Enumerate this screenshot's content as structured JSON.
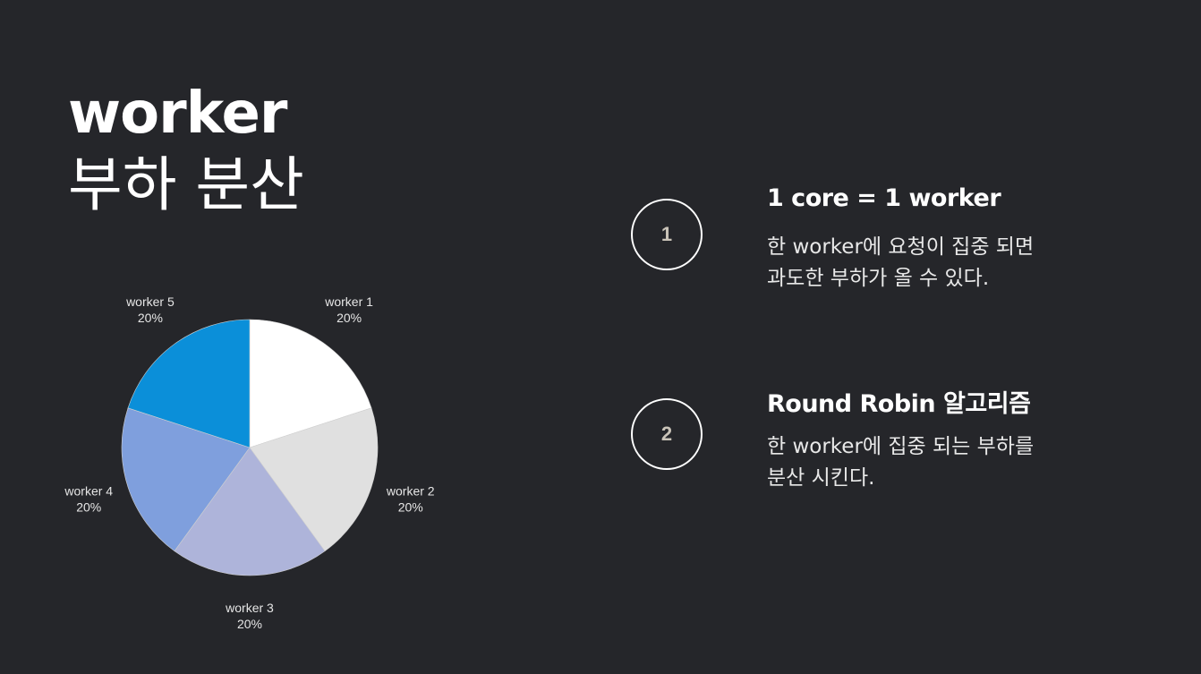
{
  "title": {
    "line1": "worker",
    "line2": "부하 분산"
  },
  "steps": [
    {
      "number": "1",
      "heading": "1 core = 1 worker",
      "body_line1": "한 worker에 요청이 집중 되면",
      "body_line2": "과도한 부하가 올 수 있다."
    },
    {
      "number": "2",
      "heading": "Round Robin 알고리즘",
      "body_line1": "한 worker에 집중 되는 부하를",
      "body_line2": "분산 시킨다."
    }
  ],
  "chart_data": {
    "type": "pie",
    "categories": [
      "worker 1",
      "worker 2",
      "worker 3",
      "worker 4",
      "worker 5"
    ],
    "values": [
      20,
      20,
      20,
      20,
      20
    ],
    "value_labels": [
      "20%",
      "20%",
      "20%",
      "20%",
      "20%"
    ],
    "colors": [
      "#ffffff",
      "#e0e0e0",
      "#aeb4da",
      "#7f9fdd",
      "#0b8fd9"
    ],
    "start_angle": "12 o'clock",
    "direction": "clockwise",
    "title": "",
    "legend": "none (labels placed outside slices)"
  }
}
